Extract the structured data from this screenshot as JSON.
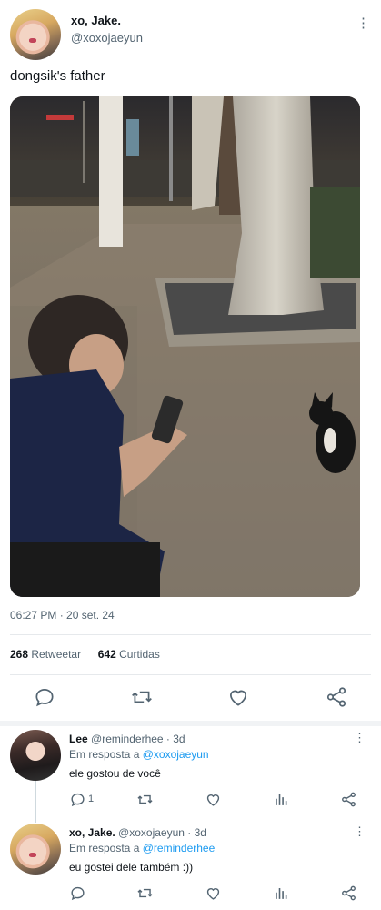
{
  "tweet": {
    "author_name": "xo, Jake.",
    "author_handle": "@xoxojaeyun",
    "text": "dongsik's father",
    "timestamp": "06:27 PM · 20 set. 24",
    "retweets_count": "268",
    "retweets_label": "Retweetar",
    "likes_count": "642",
    "likes_label": "Curtidas"
  },
  "replies": [
    {
      "author_name": "Lee",
      "meta": "@reminderhee · 3d",
      "in_reply_prefix": "Em resposta a",
      "in_reply_to": "@xoxojaeyun",
      "text": "ele gostou de você",
      "reply_count": "1"
    },
    {
      "author_name": "xo, Jake.",
      "meta": "@xoxojaeyun · 3d",
      "in_reply_prefix": "Em resposta a",
      "in_reply_to": "@reminderhee",
      "text": "eu gostei dele também :))",
      "reply_count": ""
    }
  ],
  "icons": {
    "reply": "reply-icon",
    "retweet": "retweet-icon",
    "like": "heart-icon",
    "share": "share-icon",
    "analytics": "analytics-icon",
    "more": "more-vertical-icon"
  },
  "colors": {
    "accent": "#1d9bf0",
    "secondary_text": "#536471",
    "primary_text": "#0f1419"
  }
}
